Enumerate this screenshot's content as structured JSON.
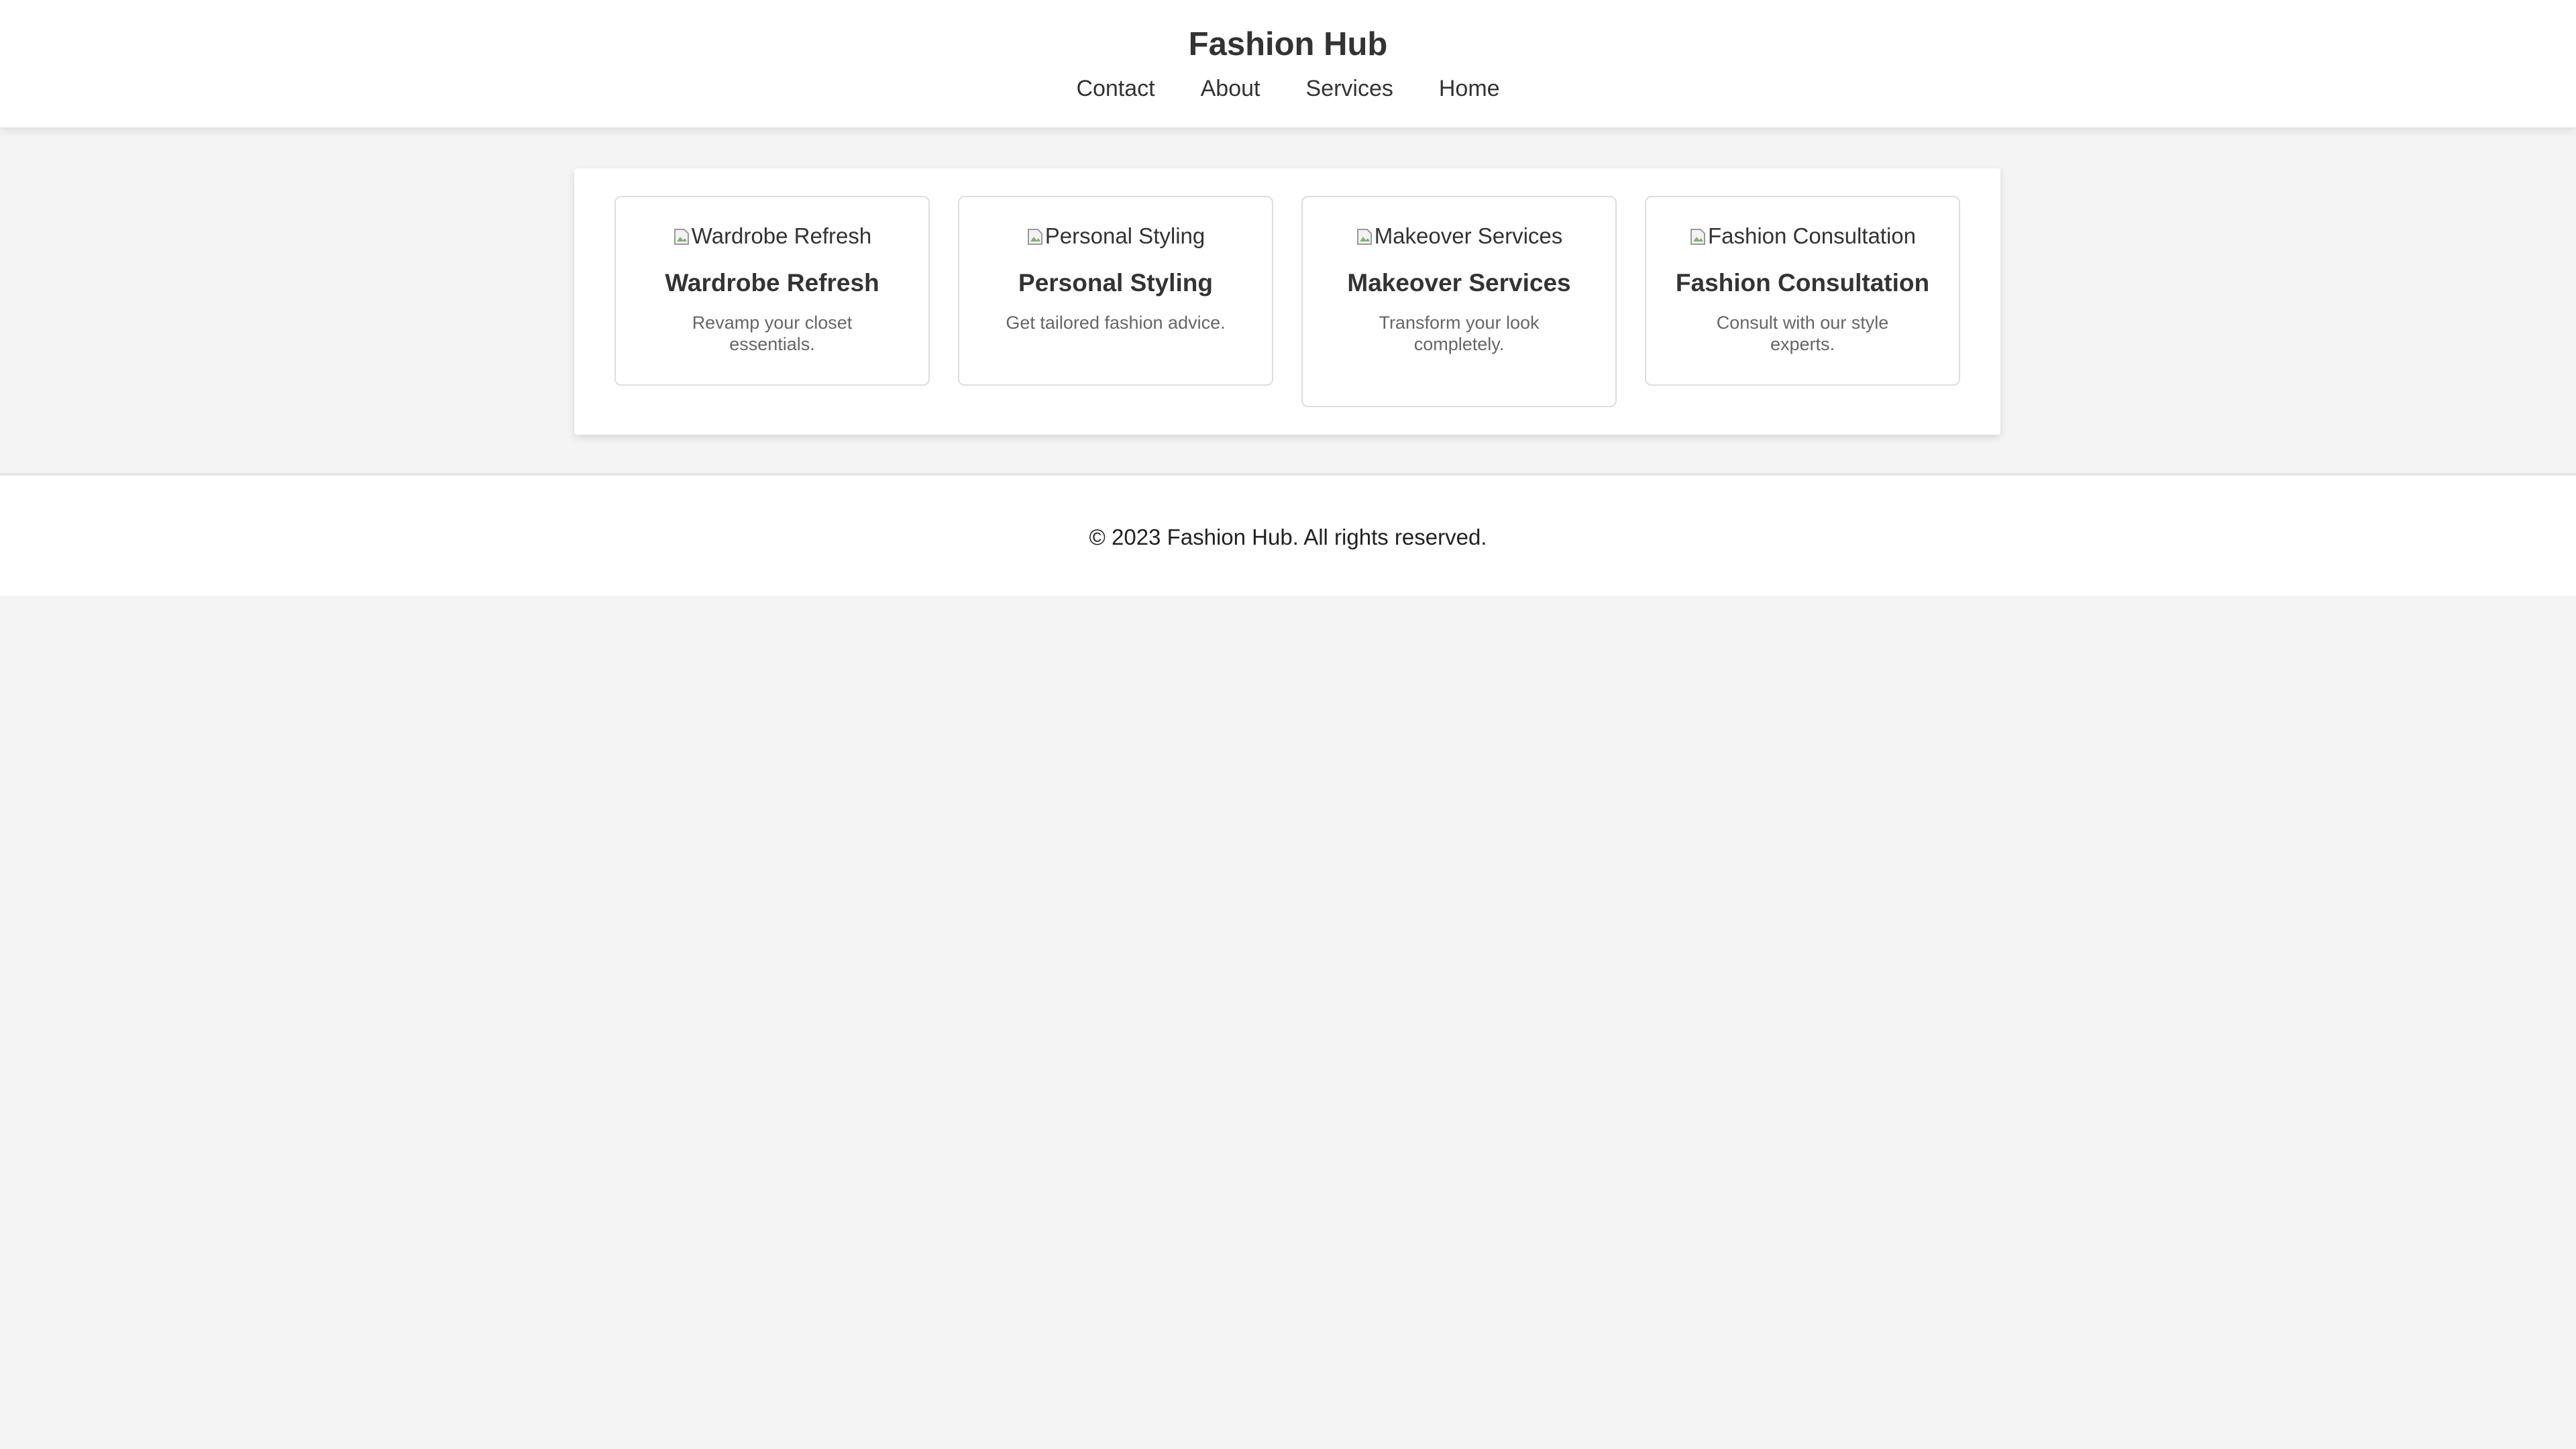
{
  "header": {
    "title": "Fashion Hub",
    "nav": [
      {
        "label": "Contact"
      },
      {
        "label": "About"
      },
      {
        "label": "Services"
      },
      {
        "label": "Home"
      }
    ]
  },
  "services": [
    {
      "image_alt": "Wardrobe Refresh",
      "title": "Wardrobe Refresh",
      "description": "Revamp your closet essentials."
    },
    {
      "image_alt": "Personal Styling",
      "title": "Personal Styling",
      "description": "Get tailored fashion advice."
    },
    {
      "image_alt": "Makeover Services",
      "title": "Makeover Services",
      "description": "Transform your look completely."
    },
    {
      "image_alt": "Fashion Consultation",
      "title": "Fashion Consultation",
      "description": "Consult with our style experts."
    }
  ],
  "footer": {
    "copyright": "© 2023 Fashion Hub. All rights reserved."
  },
  "colors": {
    "page_background": "#f4f4f4",
    "surface": "#ffffff",
    "text": "#333333",
    "muted_text": "#666666",
    "card_border": "#dedede"
  }
}
